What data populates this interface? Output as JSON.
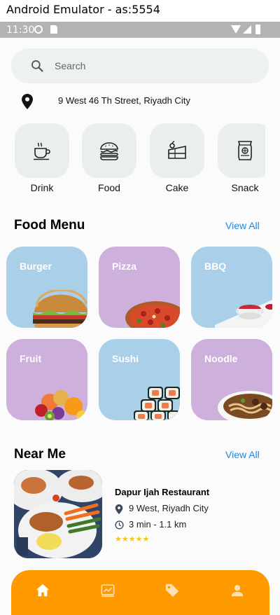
{
  "window": {
    "title": "Android Emulator - as:5554"
  },
  "status_bar": {
    "time": "11:30"
  },
  "search": {
    "placeholder": "Search"
  },
  "location": {
    "address": "9 West 46 Th Street, Riyadh City"
  },
  "categories": [
    {
      "label": "Drink",
      "icon": "cup-icon"
    },
    {
      "label": "Food",
      "icon": "burger-icon"
    },
    {
      "label": "Cake",
      "icon": "cake-icon"
    },
    {
      "label": "Snack",
      "icon": "snack-icon"
    }
  ],
  "food_menu": {
    "title": "Food Menu",
    "view_all": "View All",
    "items": [
      {
        "name": "Burger",
        "color": "#a9cfe9"
      },
      {
        "name": "Pizza",
        "color": "#cdb0dc"
      },
      {
        "name": "BBQ",
        "color": "#a9cfe9"
      },
      {
        "name": "Fruit",
        "color": "#cdb0dc"
      },
      {
        "name": "Sushi",
        "color": "#a9cfe9"
      },
      {
        "name": "Noodle",
        "color": "#cdb0dc"
      }
    ]
  },
  "near_me": {
    "title": "Near Me",
    "view_all": "View All",
    "restaurants": [
      {
        "name": "Dapur Ijah Restaurant",
        "address": "9 West, Riyadh City",
        "distance": "3 min - 1.1 km",
        "rating": 5
      }
    ]
  },
  "bottom_nav": {
    "color": "#ff9900",
    "items": [
      {
        "icon": "home-icon",
        "active": true
      },
      {
        "icon": "chart-icon",
        "active": false
      },
      {
        "icon": "tag-icon",
        "active": false
      },
      {
        "icon": "profile-icon",
        "active": false
      }
    ]
  }
}
